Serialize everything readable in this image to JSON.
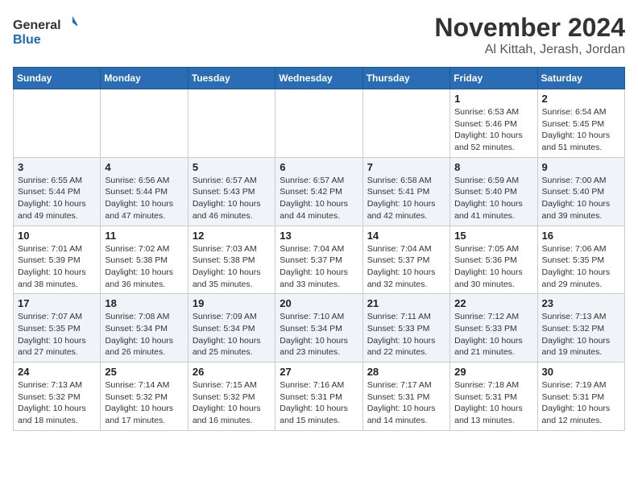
{
  "header": {
    "logo_general": "General",
    "logo_blue": "Blue",
    "month": "November 2024",
    "location": "Al Kittah, Jerash, Jordan"
  },
  "weekdays": [
    "Sunday",
    "Monday",
    "Tuesday",
    "Wednesday",
    "Thursday",
    "Friday",
    "Saturday"
  ],
  "weeks": [
    [
      {
        "day": "",
        "info": ""
      },
      {
        "day": "",
        "info": ""
      },
      {
        "day": "",
        "info": ""
      },
      {
        "day": "",
        "info": ""
      },
      {
        "day": "",
        "info": ""
      },
      {
        "day": "1",
        "info": "Sunrise: 6:53 AM\nSunset: 5:46 PM\nDaylight: 10 hours and 52 minutes."
      },
      {
        "day": "2",
        "info": "Sunrise: 6:54 AM\nSunset: 5:45 PM\nDaylight: 10 hours and 51 minutes."
      }
    ],
    [
      {
        "day": "3",
        "info": "Sunrise: 6:55 AM\nSunset: 5:44 PM\nDaylight: 10 hours and 49 minutes."
      },
      {
        "day": "4",
        "info": "Sunrise: 6:56 AM\nSunset: 5:44 PM\nDaylight: 10 hours and 47 minutes."
      },
      {
        "day": "5",
        "info": "Sunrise: 6:57 AM\nSunset: 5:43 PM\nDaylight: 10 hours and 46 minutes."
      },
      {
        "day": "6",
        "info": "Sunrise: 6:57 AM\nSunset: 5:42 PM\nDaylight: 10 hours and 44 minutes."
      },
      {
        "day": "7",
        "info": "Sunrise: 6:58 AM\nSunset: 5:41 PM\nDaylight: 10 hours and 42 minutes."
      },
      {
        "day": "8",
        "info": "Sunrise: 6:59 AM\nSunset: 5:40 PM\nDaylight: 10 hours and 41 minutes."
      },
      {
        "day": "9",
        "info": "Sunrise: 7:00 AM\nSunset: 5:40 PM\nDaylight: 10 hours and 39 minutes."
      }
    ],
    [
      {
        "day": "10",
        "info": "Sunrise: 7:01 AM\nSunset: 5:39 PM\nDaylight: 10 hours and 38 minutes."
      },
      {
        "day": "11",
        "info": "Sunrise: 7:02 AM\nSunset: 5:38 PM\nDaylight: 10 hours and 36 minutes."
      },
      {
        "day": "12",
        "info": "Sunrise: 7:03 AM\nSunset: 5:38 PM\nDaylight: 10 hours and 35 minutes."
      },
      {
        "day": "13",
        "info": "Sunrise: 7:04 AM\nSunset: 5:37 PM\nDaylight: 10 hours and 33 minutes."
      },
      {
        "day": "14",
        "info": "Sunrise: 7:04 AM\nSunset: 5:37 PM\nDaylight: 10 hours and 32 minutes."
      },
      {
        "day": "15",
        "info": "Sunrise: 7:05 AM\nSunset: 5:36 PM\nDaylight: 10 hours and 30 minutes."
      },
      {
        "day": "16",
        "info": "Sunrise: 7:06 AM\nSunset: 5:35 PM\nDaylight: 10 hours and 29 minutes."
      }
    ],
    [
      {
        "day": "17",
        "info": "Sunrise: 7:07 AM\nSunset: 5:35 PM\nDaylight: 10 hours and 27 minutes."
      },
      {
        "day": "18",
        "info": "Sunrise: 7:08 AM\nSunset: 5:34 PM\nDaylight: 10 hours and 26 minutes."
      },
      {
        "day": "19",
        "info": "Sunrise: 7:09 AM\nSunset: 5:34 PM\nDaylight: 10 hours and 25 minutes."
      },
      {
        "day": "20",
        "info": "Sunrise: 7:10 AM\nSunset: 5:34 PM\nDaylight: 10 hours and 23 minutes."
      },
      {
        "day": "21",
        "info": "Sunrise: 7:11 AM\nSunset: 5:33 PM\nDaylight: 10 hours and 22 minutes."
      },
      {
        "day": "22",
        "info": "Sunrise: 7:12 AM\nSunset: 5:33 PM\nDaylight: 10 hours and 21 minutes."
      },
      {
        "day": "23",
        "info": "Sunrise: 7:13 AM\nSunset: 5:32 PM\nDaylight: 10 hours and 19 minutes."
      }
    ],
    [
      {
        "day": "24",
        "info": "Sunrise: 7:13 AM\nSunset: 5:32 PM\nDaylight: 10 hours and 18 minutes."
      },
      {
        "day": "25",
        "info": "Sunrise: 7:14 AM\nSunset: 5:32 PM\nDaylight: 10 hours and 17 minutes."
      },
      {
        "day": "26",
        "info": "Sunrise: 7:15 AM\nSunset: 5:32 PM\nDaylight: 10 hours and 16 minutes."
      },
      {
        "day": "27",
        "info": "Sunrise: 7:16 AM\nSunset: 5:31 PM\nDaylight: 10 hours and 15 minutes."
      },
      {
        "day": "28",
        "info": "Sunrise: 7:17 AM\nSunset: 5:31 PM\nDaylight: 10 hours and 14 minutes."
      },
      {
        "day": "29",
        "info": "Sunrise: 7:18 AM\nSunset: 5:31 PM\nDaylight: 10 hours and 13 minutes."
      },
      {
        "day": "30",
        "info": "Sunrise: 7:19 AM\nSunset: 5:31 PM\nDaylight: 10 hours and 12 minutes."
      }
    ]
  ]
}
